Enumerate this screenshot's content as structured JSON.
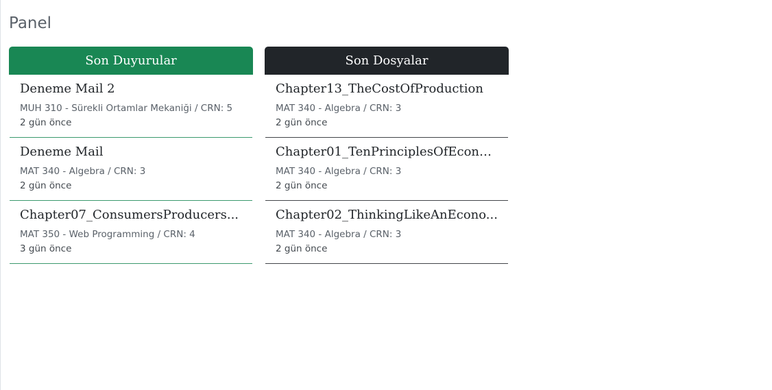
{
  "page": {
    "title": "Panel"
  },
  "announcements": {
    "header": "Son Duyurular",
    "items": [
      {
        "title": "Deneme Mail 2",
        "course": "MUH 310 - Sürekli Ortamlar Mekaniği / CRN: 5",
        "time": "2 gün önce"
      },
      {
        "title": "Deneme Mail",
        "course": "MAT 340 - Algebra / CRN: 3",
        "time": "2 gün önce"
      },
      {
        "title": "Chapter07_ConsumersProducers...",
        "course": "MAT 350 - Web Programming / CRN: 4",
        "time": "3 gün önce"
      }
    ]
  },
  "files": {
    "header": "Son Dosyalar",
    "items": [
      {
        "title": "Chapter13_TheCostOfProduction",
        "course": "MAT 340 - Algebra / CRN: 3",
        "time": "2 gün önce"
      },
      {
        "title": "Chapter01_TenPrinciplesOfEcono...",
        "course": "MAT 340 - Algebra / CRN: 3",
        "time": "2 gün önce"
      },
      {
        "title": "Chapter02_ThinkingLikeAnEcono...",
        "course": "MAT 340 - Algebra / CRN: 3",
        "time": "2 gün önce"
      }
    ]
  },
  "colors": {
    "announcements_header": "#198754",
    "files_header": "#212529",
    "title_text": "#5a6169"
  }
}
